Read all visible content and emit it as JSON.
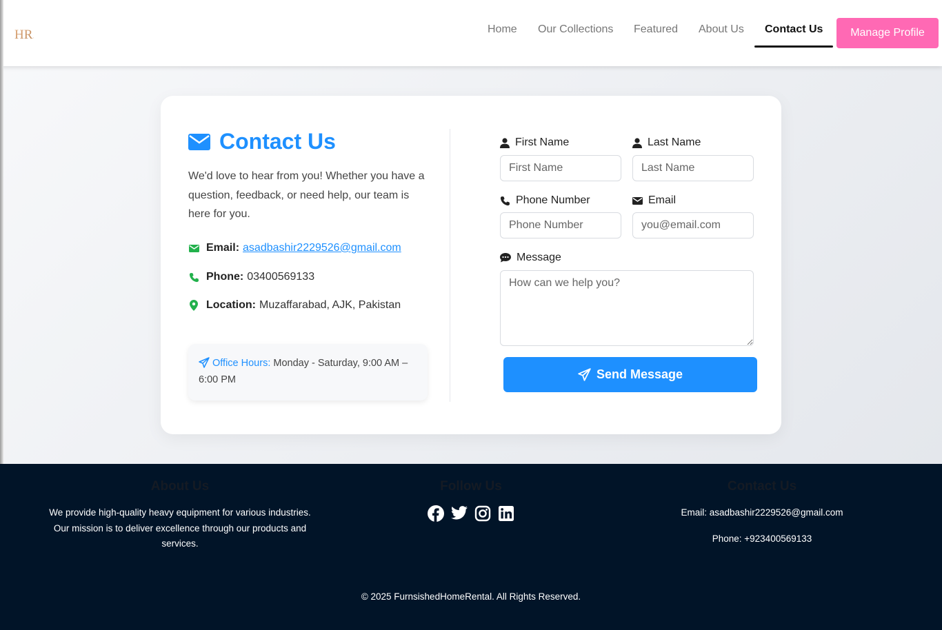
{
  "header": {
    "logo_text": "HR.",
    "nav": [
      {
        "label": "Home"
      },
      {
        "label": "Our Collections"
      },
      {
        "label": "Featured"
      },
      {
        "label": "About Us"
      },
      {
        "label": "Contact Us",
        "active": true
      }
    ],
    "manage_profile_label": "Manage Profile"
  },
  "contact": {
    "title": "Contact Us",
    "intro": "We'd love to hear from you! Whether you have a question, feedback, or need help, our team is here for you.",
    "email_label": "Email:",
    "email_value": "asadbashir2229526@gmail.com",
    "phone_label": "Phone:",
    "phone_value": "03400569133",
    "location_label": "Location:",
    "location_value": "Muzaffarabad, AJK, Pakistan",
    "hours_label": "Office Hours:",
    "hours_value": "Monday - Saturday, 9:00 AM – 6:00 PM"
  },
  "form": {
    "first_name_label": "First Name",
    "first_name_placeholder": "First Name",
    "first_name_value": "",
    "last_name_label": "Last Name",
    "last_name_placeholder": "Last Name",
    "last_name_value": "",
    "phone_label": "Phone Number",
    "phone_placeholder": "Phone Number",
    "phone_value": "",
    "email_label": "Email",
    "email_placeholder": "you@email.com",
    "email_value": "",
    "message_label": "Message",
    "message_placeholder": "How can we help you?",
    "message_value": "",
    "send_label": "Send Message"
  },
  "footer": {
    "about_title": "About Us",
    "about_text": "We provide high-quality heavy equipment for various industries. Our mission is to deliver excellence through our products and services.",
    "follow_title": "Follow Us",
    "socials": [
      "facebook-icon",
      "twitter-icon",
      "instagram-icon",
      "linkedin-icon"
    ],
    "contact_title": "Contact Us",
    "contact_email": "Email: asadbashir2229526@gmail.com",
    "contact_phone": "Phone: +923400569133",
    "copyright": "© 2025 FurnsishedHomeRental. All Rights Reserved."
  },
  "colors": {
    "accent_blue": "#1e90ff",
    "manage_pink": "#ff69b4",
    "icon_green": "#22b14c",
    "footer_bg": "#011428"
  }
}
